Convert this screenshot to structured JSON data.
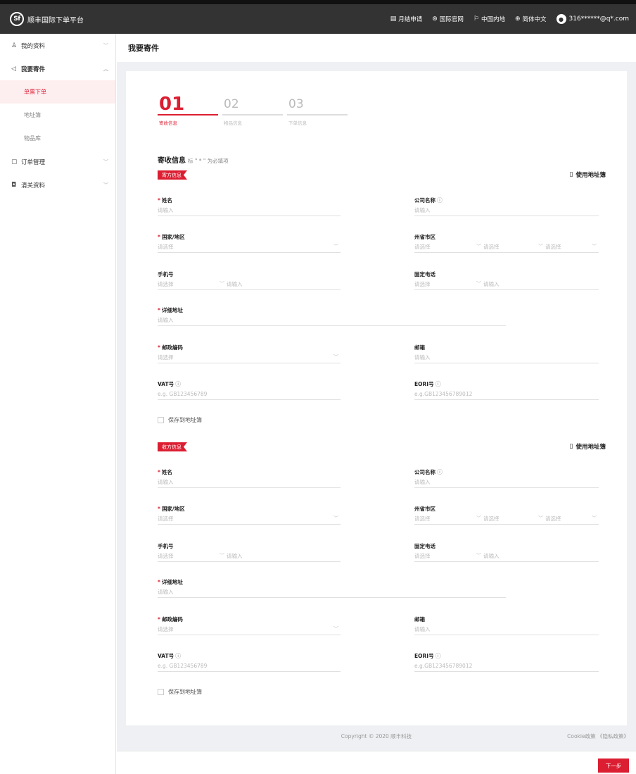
{
  "app": {
    "logo_mark": "Sf",
    "title": "顺丰国际下单平台"
  },
  "topnav": [
    {
      "icon": "calendar-icon",
      "glyph": "▤",
      "label": "月结申请"
    },
    {
      "icon": "globe-icon",
      "glyph": "⊛",
      "label": "国际官网"
    },
    {
      "icon": "flag-icon",
      "glyph": "⚐",
      "label": "中国内地"
    },
    {
      "icon": "language-icon",
      "glyph": "⊕",
      "label": "简体中文"
    }
  ],
  "user": {
    "email": "316******@q*.com"
  },
  "sidebar": {
    "items": [
      {
        "label": "我的资料",
        "icon_glyph": "♙"
      },
      {
        "label": "我要寄件",
        "icon_glyph": "◁"
      },
      {
        "label": "订单管理",
        "icon_glyph": "▢"
      },
      {
        "label": "清关资料",
        "icon_glyph": "◘"
      }
    ],
    "sub_items": [
      "单票下单",
      "地址簿",
      "物品库"
    ]
  },
  "page": {
    "title": "我要寄件"
  },
  "steps": [
    {
      "num": "01",
      "label": "寄收信息"
    },
    {
      "num": "02",
      "label": "物品信息"
    },
    {
      "num": "03",
      "label": "下单信息"
    }
  ],
  "section": {
    "title": "寄收信息",
    "hint": "标 \" * \" 为必填项"
  },
  "sender": {
    "tag": "寄方信息"
  },
  "receiver": {
    "tag": "收方信息"
  },
  "use_address_book": "使用地址簿",
  "fields": {
    "name": "姓名",
    "company": "公司名称",
    "country": "国家/地区",
    "province": "州省市区",
    "mobile": "手机号",
    "landline": "固定电话",
    "address": "详细地址",
    "postcode": "邮政编码",
    "email": "邮箱",
    "vat": "VAT号",
    "eori": "EORI号"
  },
  "placeholders": {
    "input": "请输入",
    "select": "请选择",
    "vat": "e.g. GB123456789",
    "eori": "e.g.GB123456789012"
  },
  "save_to_book": "保存到地址簿",
  "footer": {
    "copyright": "Copyright © 2020 顺丰科技",
    "cookie": "Cookie政策",
    "privacy": "《隐私政策》"
  },
  "next_button": "下一步"
}
